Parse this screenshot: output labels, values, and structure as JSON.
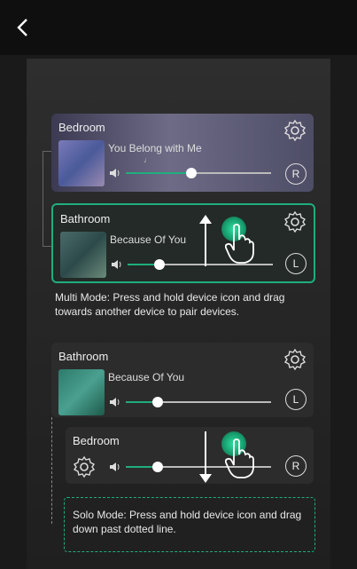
{
  "header": {
    "back_icon": "chevron-left-icon",
    "back_glyph": "‹"
  },
  "multi": {
    "bedroom": {
      "title": "Bedroom",
      "song": "You Belong with Me",
      "song_sub": "♩",
      "badge": "R",
      "volume": 0.55
    },
    "bathroom": {
      "title": "Bathroom",
      "song": "Because Of You",
      "badge": "L",
      "volume": 0.35
    },
    "instruction": "Multi Mode: Press and hold device icon and drag towards another device to pair devices."
  },
  "solo": {
    "bathroom": {
      "title": "Bathroom",
      "song": "Because Of You",
      "badge": "L",
      "volume": 0.35
    },
    "bedroom": {
      "title": "Bedroom",
      "badge": "R",
      "volume": 0.35
    },
    "instruction": "Solo Mode: Press and hold device icon and drag down past dotted line."
  },
  "colors": {
    "accent": "#1fae7c",
    "background": "#1a1a1a"
  }
}
